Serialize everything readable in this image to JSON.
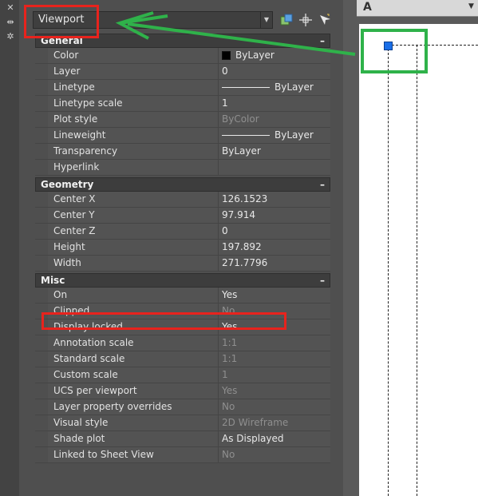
{
  "selector": {
    "value": "Viewport"
  },
  "sections": [
    {
      "title": "General",
      "rows": [
        {
          "name": "Color",
          "value": "ByLayer",
          "kind": "color"
        },
        {
          "name": "Layer",
          "value": "0"
        },
        {
          "name": "Linetype",
          "value": "ByLayer",
          "kind": "line"
        },
        {
          "name": "Linetype scale",
          "value": "1"
        },
        {
          "name": "Plot style",
          "value": "ByColor",
          "dim": true
        },
        {
          "name": "Lineweight",
          "value": "ByLayer",
          "kind": "line"
        },
        {
          "name": "Transparency",
          "value": "ByLayer"
        },
        {
          "name": "Hyperlink",
          "value": ""
        }
      ]
    },
    {
      "title": "Geometry",
      "rows": [
        {
          "name": "Center X",
          "value": "126.1523"
        },
        {
          "name": "Center Y",
          "value": "97.914"
        },
        {
          "name": "Center Z",
          "value": "0"
        },
        {
          "name": "Height",
          "value": "197.892"
        },
        {
          "name": "Width",
          "value": "271.7796"
        }
      ]
    },
    {
      "title": "Misc",
      "rows": [
        {
          "name": "On",
          "value": "Yes"
        },
        {
          "name": "Clipped",
          "value": "No",
          "dim": true
        },
        {
          "name": "Display locked",
          "value": "Yes"
        },
        {
          "name": "Annotation scale",
          "value": "1:1",
          "dim": true
        },
        {
          "name": "Standard scale",
          "value": "1:1",
          "dim": true
        },
        {
          "name": "Custom scale",
          "value": "1",
          "dim": true
        },
        {
          "name": "UCS per viewport",
          "value": "Yes",
          "dim": true
        },
        {
          "name": "Layer property overrides",
          "value": "No",
          "dim": true
        },
        {
          "name": "Visual style",
          "value": "2D Wireframe",
          "dim": true
        },
        {
          "name": "Shade plot",
          "value": "As Displayed"
        },
        {
          "name": "Linked to Sheet View",
          "value": "No",
          "dim": true
        }
      ]
    }
  ],
  "colors": {
    "highlight": "#e8231d",
    "green": "#2fb24a",
    "grip": "#1a6fe8"
  }
}
